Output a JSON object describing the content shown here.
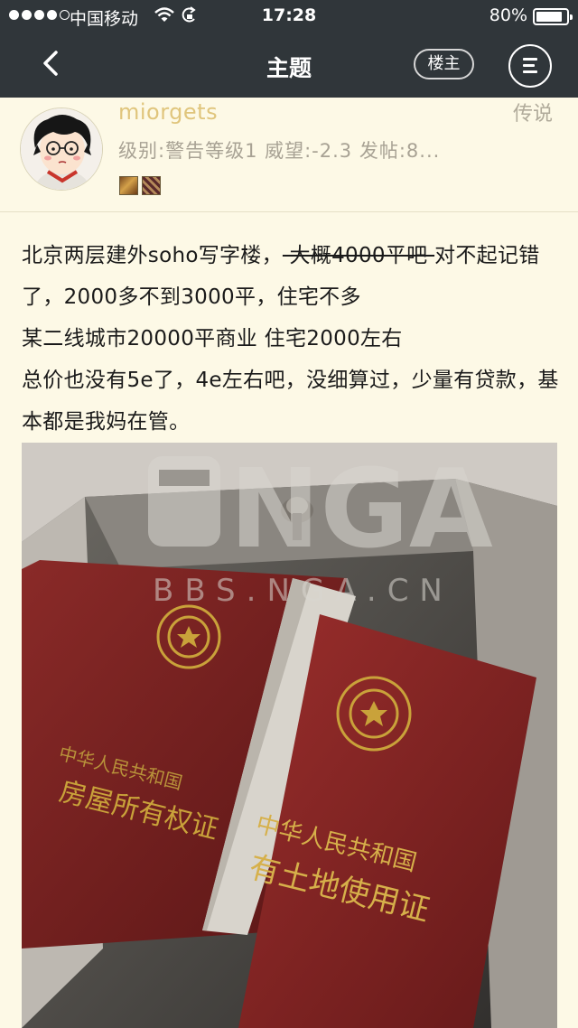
{
  "status_bar": {
    "carrier": "中国移动",
    "time": "17:28",
    "battery_percent": "80%",
    "battery_level": 0.8
  },
  "nav": {
    "title": "主题",
    "op_button_label": "楼主"
  },
  "post": {
    "username": "miorgets",
    "rank": "传说",
    "meta": "级别:警告等级1  威望:-2.3  发帖:8...",
    "line1_prefix": "北京两层建外soho写字楼，",
    "line1_struck": " 大概4000平吧 ",
    "line1_suffix": "对不起记错了，2000多不到3000平，住宅不多",
    "line2": "某二线城市20000平商业 住宅2000左右",
    "line3": "总价也没有5e了，4e左右吧，没细算过，少量有贷款，基本都是我妈在管。",
    "image": {
      "watermark_logo": "NGA",
      "watermark_url": "BBS.NGA.CN",
      "booklet_left_line1": "中华人民共和国",
      "booklet_left_line2": "房屋所有权证",
      "booklet_right_line1": "中华人民共和国",
      "booklet_right_line2": "有土地使用证"
    }
  },
  "colors": {
    "topbar": "#30363a",
    "page_background": "#fdf9e6",
    "username": "#e0c57c",
    "meta_text": "#a8a294"
  }
}
